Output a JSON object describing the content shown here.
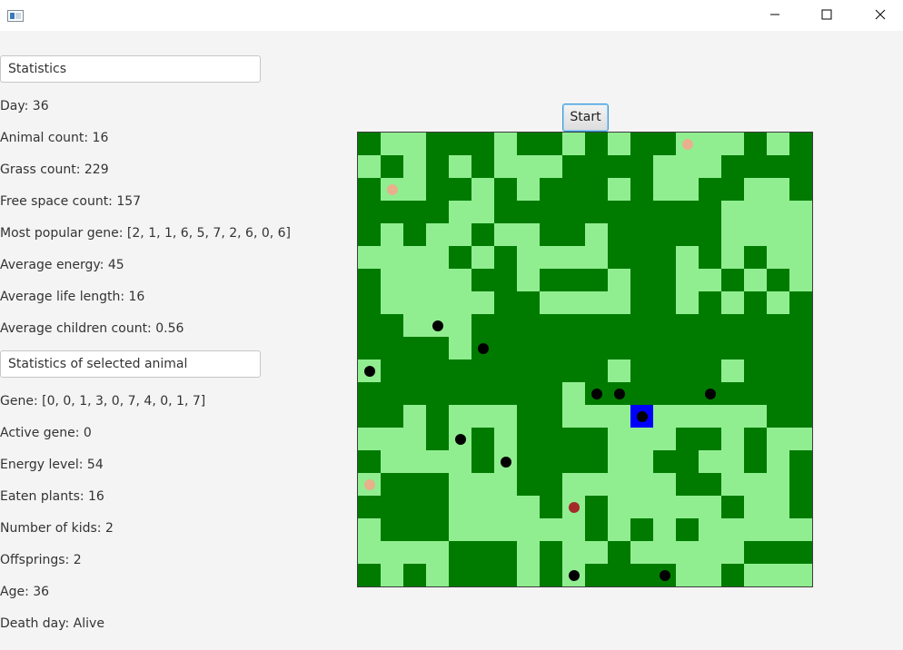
{
  "window": {
    "title": "",
    "controls": {
      "minimize_icon": "minimize-icon",
      "maximize_icon": "maximize-icon",
      "close_icon": "close-icon"
    }
  },
  "stats_header": "Statistics",
  "stats": [
    "Day: 36",
    "Animal count: 16",
    "Grass count: 229",
    "Free space count: 157",
    "Most popular gene: [2, 1, 1, 6, 5, 7, 2, 6, 0, 6]",
    "Average energy: 45",
    "Average life length: 16",
    "Average children count: 0.56"
  ],
  "selected_header": "Statistics of selected animal",
  "selected_stats": [
    "Gene: [0, 0, 1, 3, 0, 7, 4, 0, 1, 7]",
    "Active gene: 0",
    "Energy level: 54",
    "Eaten plants: 16",
    "Number of kids: 2",
    "Offsprings: 2",
    "Age: 36",
    "Death day: Alive"
  ],
  "start_label": "Start",
  "map": {
    "colors": {
      "jungle": "#007b00",
      "steppe": "#90ee90",
      "selected": "#0000ff",
      "animal": "#000000",
      "weak_animal": "#e8b08c",
      "marked_animal": "#a52a2a"
    },
    "rows": [
      "jssjjjsjjsjsjjsssjsj",
      "sjsjsjsssjjjjsssjjjj",
      "jssjjsjsjjjsjssjjssj",
      "jjjjssjjjjjjjjjjssss",
      "jsjssjssjjsjjjjjssss",
      "ssssjsjssssjjjsjsjss",
      "jssssjjsjjjsjjssjsjs",
      "jsssssjjssssjjsjsjsj",
      "jjsssjjjjjjjjjjjjjjj",
      "jjjjsjjjjjjjjjjjjjjj",
      "sjjjjjjjjjjsjjjjsjjj",
      "jjjjjjjjjsjjjjjjjjjj",
      "jjsjsssjjsssbsssssjj",
      "sssjsjsjjjjsssjjsjss",
      "jssssjsjjjjssjjssjsj",
      "sjjjsssjjsssssjjsssj",
      "jjjjssssjsjsssssjssj",
      "sjjjssssssjsjsjsssssj",
      "ssssjjjsjssjsssssjjj",
      "jsjsjjjsjsjjjjssjsss"
    ],
    "animals": [
      {
        "row": 0,
        "col": 14,
        "kind": "weak_animal"
      },
      {
        "row": 2,
        "col": 1,
        "kind": "weak_animal"
      },
      {
        "row": 8,
        "col": 3,
        "kind": "animal"
      },
      {
        "row": 9,
        "col": 5,
        "kind": "animal"
      },
      {
        "row": 10,
        "col": 0,
        "kind": "animal"
      },
      {
        "row": 11,
        "col": 10,
        "kind": "animal"
      },
      {
        "row": 11,
        "col": 11,
        "kind": "animal"
      },
      {
        "row": 11,
        "col": 15,
        "kind": "animal"
      },
      {
        "row": 12,
        "col": 12,
        "kind": "animal"
      },
      {
        "row": 13,
        "col": 4,
        "kind": "animal"
      },
      {
        "row": 14,
        "col": 6,
        "kind": "animal"
      },
      {
        "row": 15,
        "col": 0,
        "kind": "weak_animal"
      },
      {
        "row": 16,
        "col": 9,
        "kind": "marked_animal"
      },
      {
        "row": 19,
        "col": 9,
        "kind": "animal"
      },
      {
        "row": 19,
        "col": 13,
        "kind": "animal"
      }
    ]
  }
}
